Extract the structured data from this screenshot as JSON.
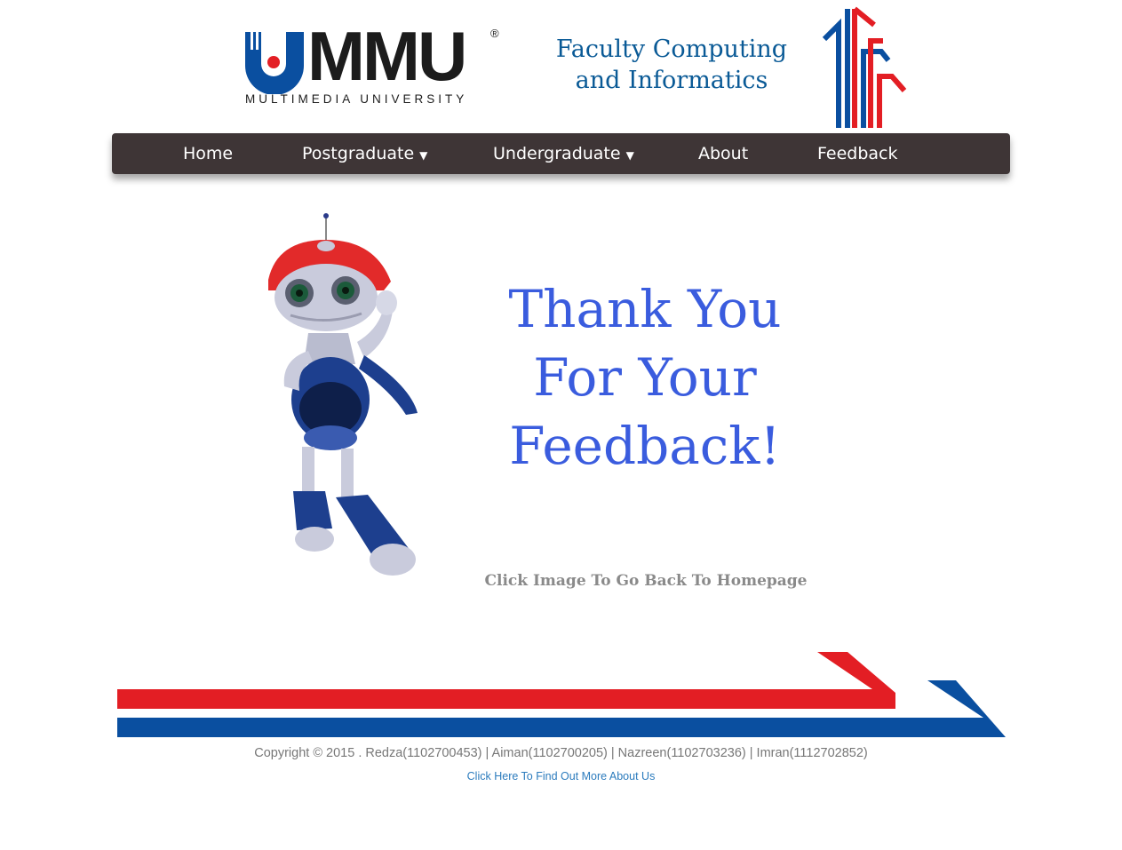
{
  "header": {
    "logo_text": "MMU",
    "logo_registered": "®",
    "logo_subtitle": "MULTIMEDIA UNIVERSITY",
    "faculty_line1": "Faculty Computing",
    "faculty_line2": "and Informatics"
  },
  "nav": {
    "items": [
      {
        "label": "Home"
      },
      {
        "label": "Postgraduate",
        "caret": "▼"
      },
      {
        "label": "Undergraduate",
        "caret": "▼"
      },
      {
        "label": "About"
      },
      {
        "label": "Feedback"
      }
    ]
  },
  "main": {
    "thanks_line1": "Thank You",
    "thanks_line2": "For Your",
    "thanks_line3": "Feedback!",
    "click_image_text": "Click Image To Go Back To Homepage"
  },
  "footer": {
    "copyright": "Copyright © 2015 . Redza(1102700453) | Aiman(1102700205) | Nazreen(1102703236) | Imran(1112702852)",
    "about_link": "Click Here To Find Out More About Us"
  },
  "colors": {
    "brand_red": "#e31e24",
    "brand_blue": "#0a4fa0",
    "nav_bg": "#3e3536",
    "thanks_blue": "#3a5cde",
    "faculty_blue": "#0a5a96"
  }
}
